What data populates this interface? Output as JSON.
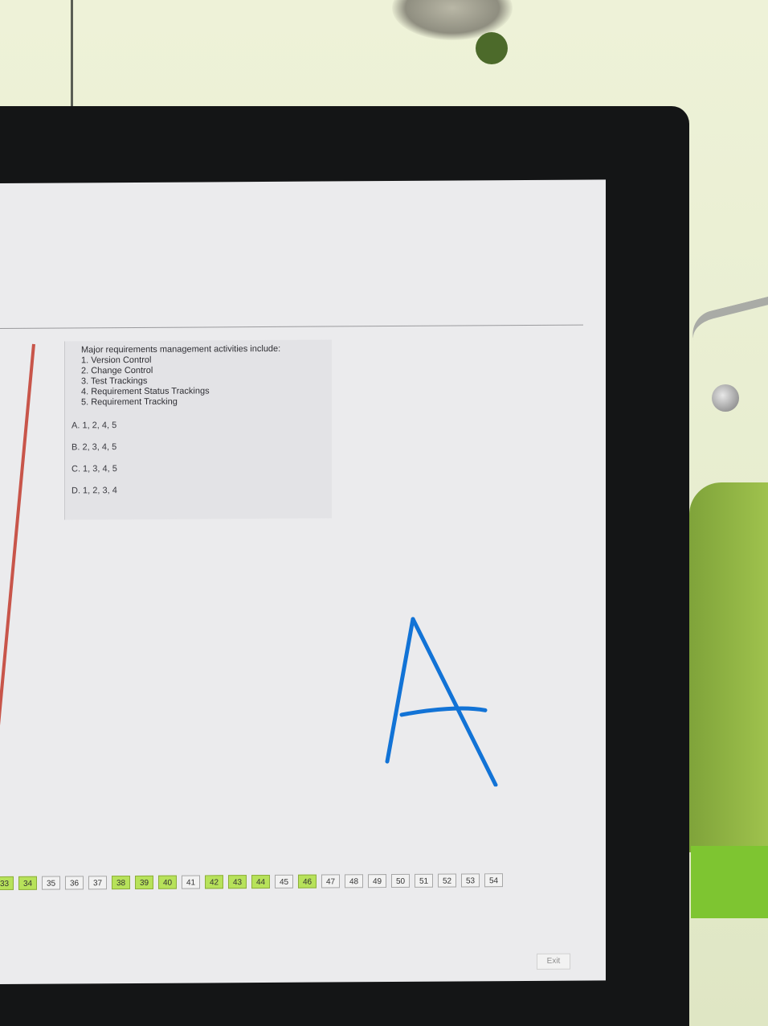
{
  "question": {
    "text_lines": [
      "Major requirements management activities include:",
      "1. Version Control",
      "2. Change Control",
      "3. Test Trackings",
      "4. Requirement Status Trackings",
      "5. Requirement Tracking"
    ],
    "options": [
      "A. 1, 2, 4, 5",
      "B. 2, 3, 4, 5",
      "C. 1, 3, 4, 5",
      "D. 1, 2, 3, 4"
    ]
  },
  "handwritten_answer": "A",
  "navigation": {
    "buttons": [
      {
        "label": "33",
        "answered": true
      },
      {
        "label": "34",
        "answered": true
      },
      {
        "label": "35",
        "answered": false
      },
      {
        "label": "36",
        "answered": false
      },
      {
        "label": "37",
        "answered": false
      },
      {
        "label": "38",
        "answered": true
      },
      {
        "label": "39",
        "answered": true
      },
      {
        "label": "40",
        "answered": true
      },
      {
        "label": "41",
        "answered": false
      },
      {
        "label": "42",
        "answered": true
      },
      {
        "label": "43",
        "answered": true
      },
      {
        "label": "44",
        "answered": true
      },
      {
        "label": "45",
        "answered": false
      },
      {
        "label": "46",
        "answered": true
      },
      {
        "label": "47",
        "answered": false
      },
      {
        "label": "48",
        "answered": false
      },
      {
        "label": "49",
        "answered": false
      },
      {
        "label": "50",
        "answered": false
      },
      {
        "label": "51",
        "answered": false
      },
      {
        "label": "52",
        "answered": false
      },
      {
        "label": "53",
        "answered": false
      },
      {
        "label": "54",
        "answered": false
      }
    ],
    "exit_label": "Exit"
  },
  "colors": {
    "answered_button": "#b7e25a",
    "marker_ink": "#1273d6",
    "accent_bar": "#c8554a"
  }
}
